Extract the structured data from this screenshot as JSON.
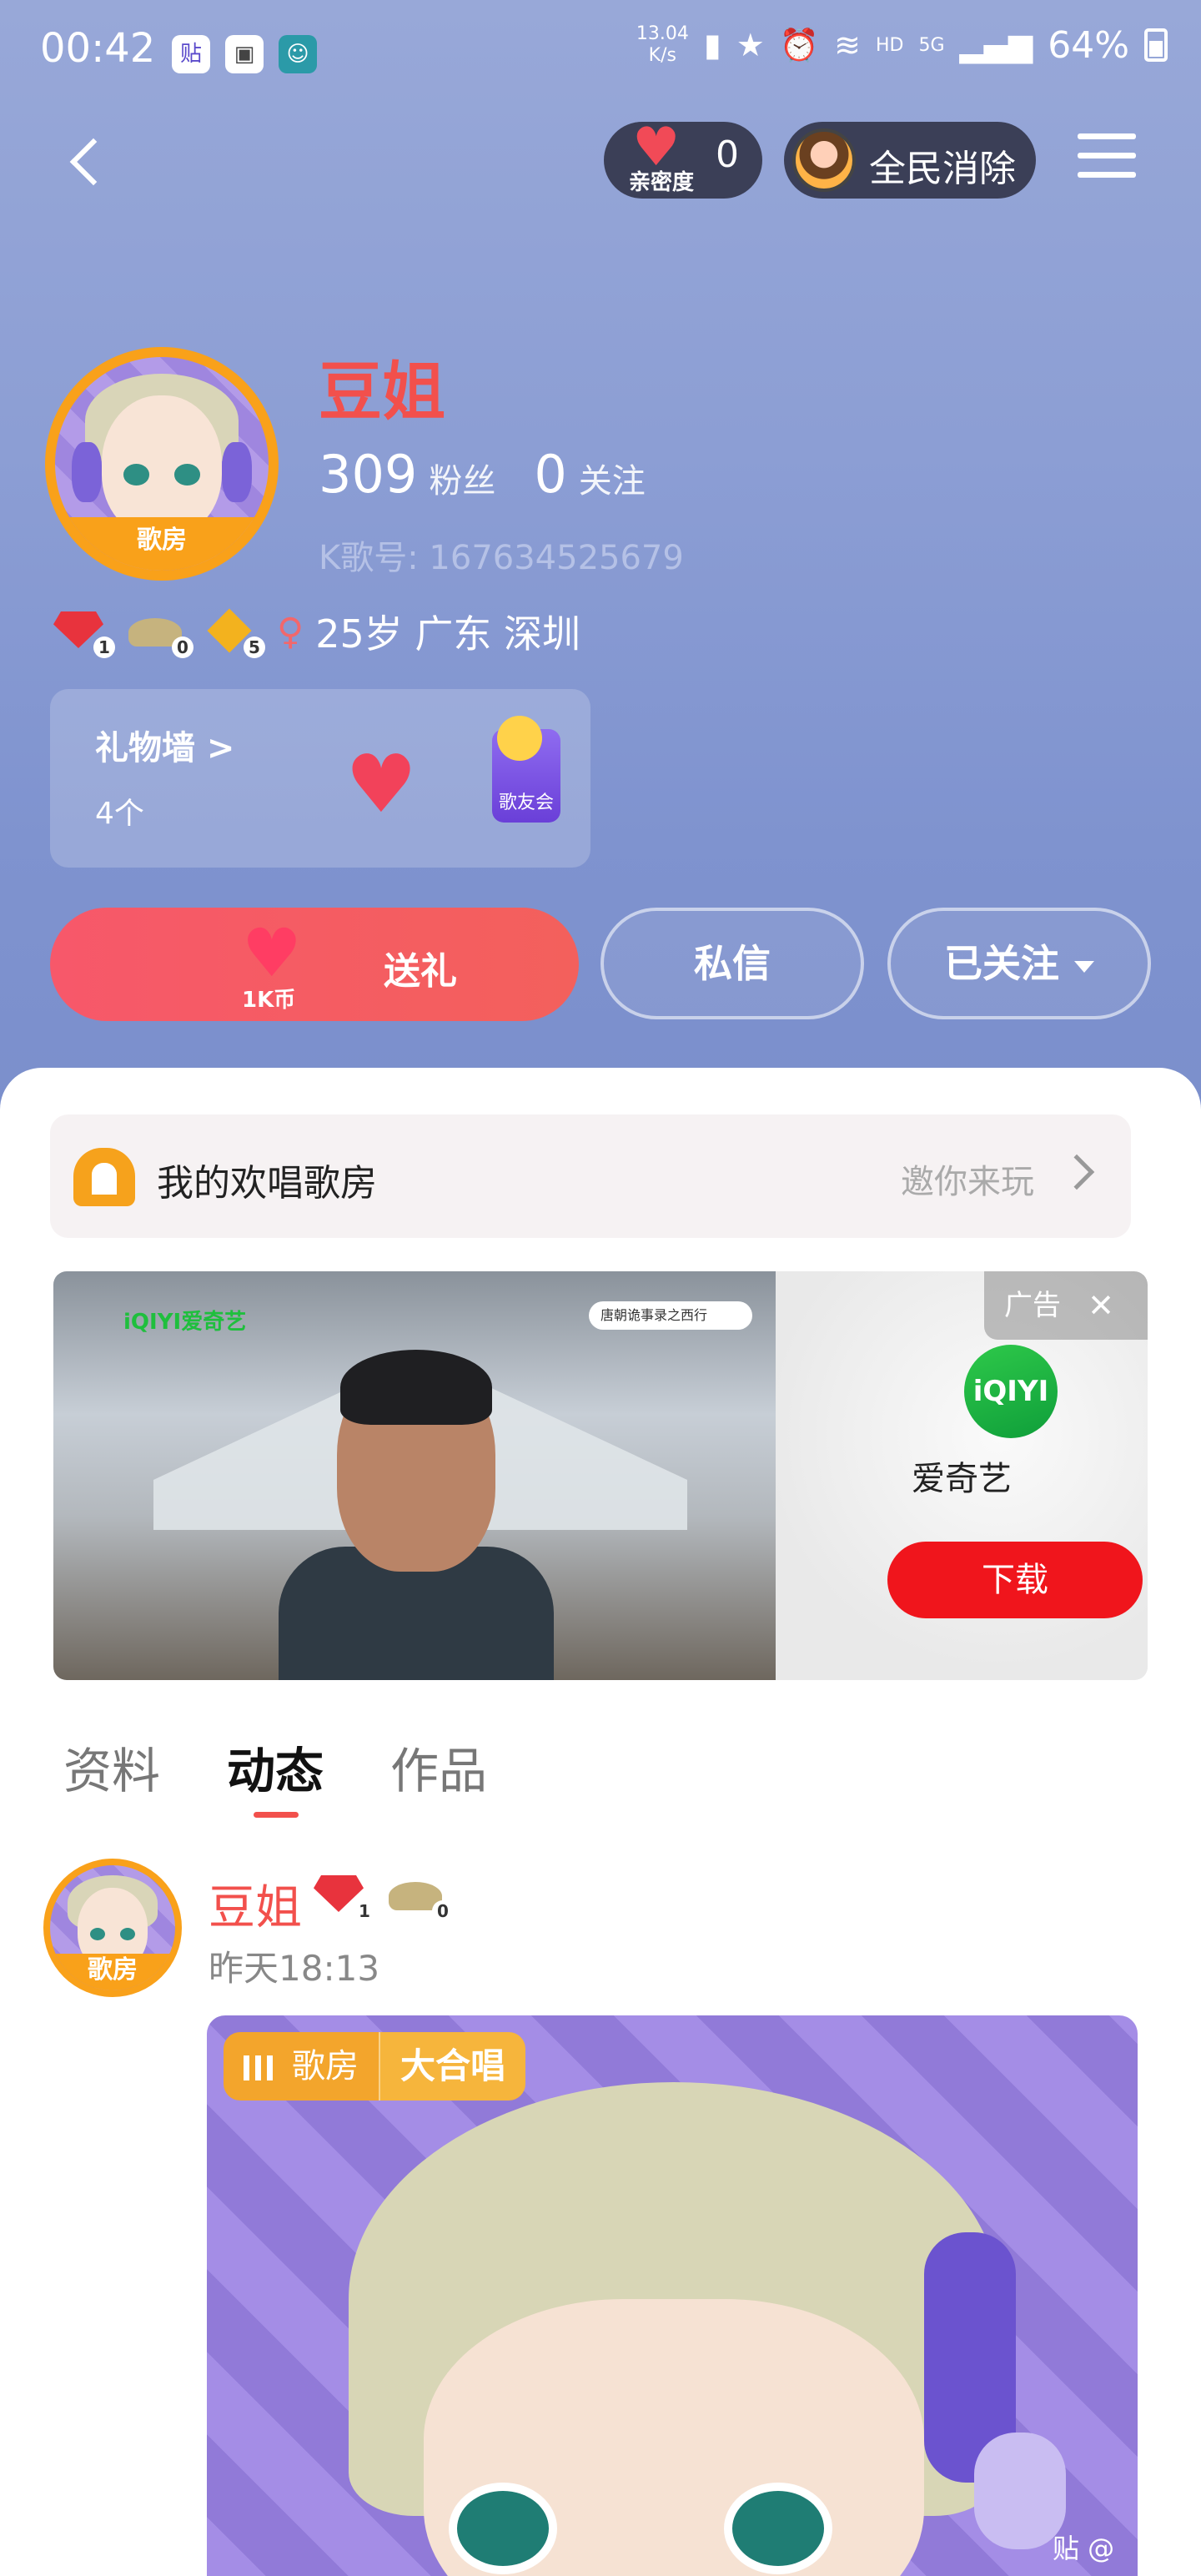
{
  "status_bar": {
    "time": "00:42",
    "app_icon_1": "贴",
    "net_speed_value": "13.04",
    "net_speed_unit": "K/s",
    "hd": "HD",
    "network": "5G",
    "battery": "64%",
    "icons": [
      "tieba-app-icon",
      "gallery-icon",
      "avatar-app-icon",
      "battery-saver-icon",
      "star-icon",
      "alarm-icon",
      "wifi-icon",
      "signal-icon",
      "battery-icon"
    ]
  },
  "nav": {
    "intimacy_label": "亲密度",
    "intimacy_value": "0",
    "game_label": "全民消除"
  },
  "profile": {
    "nickname": "豆姐",
    "avatar_badge": "歌房",
    "fans_count": "309",
    "fans_label": "粉丝",
    "following_count": "0",
    "following_label": "关注",
    "k_id": "K歌号: 167634525679",
    "badge_gem_level": "1",
    "badge_hat_level": "0",
    "badge_diamond_level": "5",
    "gender_symbol": "♀",
    "age_location": "25岁  广东 深圳"
  },
  "gift_wall": {
    "title": "礼物墙 >",
    "count": "4个",
    "item_label": "歌友会"
  },
  "actions": {
    "gift_label": "送礼",
    "gift_coin": "1K币",
    "dm_label": "私信",
    "follow_label": "已关注"
  },
  "room_card": {
    "title": "我的欢唱歌房",
    "invite": "邀你来玩"
  },
  "ad": {
    "brand_logo": "iQIYI爱奇艺",
    "search_text": "唐朝诡事录之西行",
    "tag": "广告",
    "close": "✕",
    "app_icon_text": "iQIYI",
    "app_name": "爱奇艺",
    "download_label": "下载"
  },
  "tabs": [
    {
      "label": "资料",
      "active": false
    },
    {
      "label": "动态",
      "active": true
    },
    {
      "label": "作品",
      "active": false
    }
  ],
  "feed": {
    "name": "豆姐",
    "avatar_badge": "歌房",
    "gem_level": "1",
    "hat_level": "0",
    "time": "昨天18:13",
    "room_tag": "歌房",
    "room_type": "大合唱",
    "watermark": "贴 @"
  },
  "colors": {
    "accent_red": "#f2504c",
    "hero_blue": "#8c9ed4",
    "room_orange": "#f3a52c",
    "ad_download_red": "#f0151c"
  }
}
